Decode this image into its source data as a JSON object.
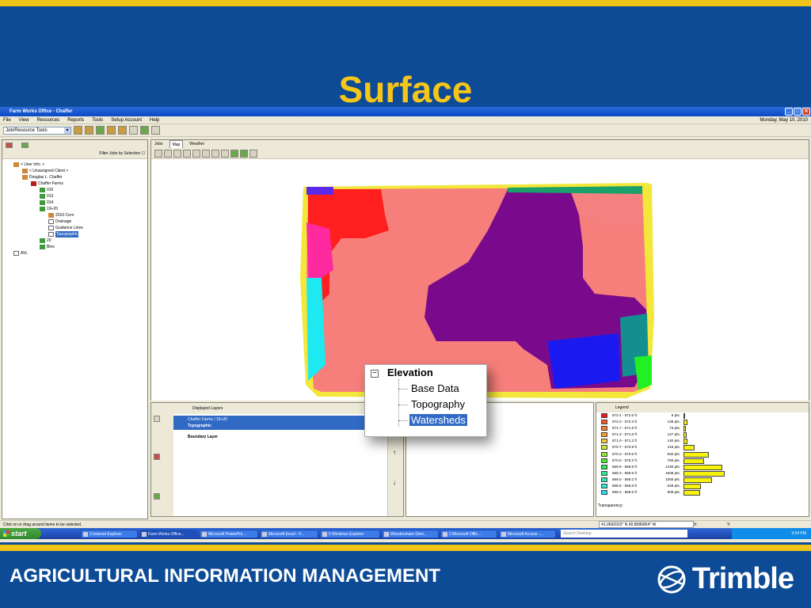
{
  "slide": {
    "title": "Surface",
    "footer": "AGRICULTURAL INFORMATION MANAGEMENT",
    "logo_text": "Trimble"
  },
  "window": {
    "title": "Farm Works Office - Chaffer"
  },
  "menu": {
    "items": [
      "File",
      "View",
      "Resources",
      "Reports",
      "Tools",
      "Setup Account",
      "Help"
    ],
    "date": "Monday, May 10, 2010"
  },
  "toolbar": {
    "selector": "Job/Resource Tools"
  },
  "left": {
    "filter_label": "Filter Jobs by Selection",
    "tree": [
      {
        "label": "< User Info. >",
        "depth": 1,
        "icon": "user"
      },
      {
        "label": "< Unassigned Client >",
        "depth": 2,
        "icon": "user"
      },
      {
        "label": "Douglas L. Chaffer",
        "depth": 2,
        "icon": "user"
      },
      {
        "label": "Chaffer Farms",
        "depth": 3,
        "icon": "farm"
      },
      {
        "label": "010",
        "depth": 4,
        "icon": "field"
      },
      {
        "label": "013",
        "depth": 4,
        "icon": "field"
      },
      {
        "label": "014",
        "depth": 4,
        "icon": "field"
      },
      {
        "label": "19+20",
        "depth": 4,
        "icon": "field"
      },
      {
        "label": "2010 Corn",
        "depth": 5,
        "icon": "user"
      },
      {
        "label": "Drainage",
        "depth": 5,
        "icon": "doc"
      },
      {
        "label": "Guidance Lines",
        "depth": 5,
        "icon": "doc"
      },
      {
        "label": "Topographic",
        "depth": 5,
        "icon": "doc",
        "selected": true
      },
      {
        "label": "20",
        "depth": 4,
        "icon": "field"
      },
      {
        "label": "Bins",
        "depth": 4,
        "icon": "field"
      },
      {
        "label": "AVL",
        "depth": 1,
        "icon": "doc"
      }
    ]
  },
  "tabs": [
    "Jobs",
    "Map",
    "Weather"
  ],
  "layers": {
    "header": "Displayed Layers",
    "selected_line1": "Chaffer Farms / 19+20",
    "selected_line2": "Topographic",
    "second": "Boundary Layer"
  },
  "legend": {
    "header": "Legend",
    "transparency": "Transparency:",
    "rows": [
      {
        "range": "572.4 - 572.6 ft",
        "count": "9 pts.",
        "color": "#e41a1a",
        "n": 9
      },
      {
        "range": "572.0 - 572.3 ft",
        "count": "139 pts.",
        "color": "#f2542a",
        "n": 139
      },
      {
        "range": "571.7 - 571.9 ft",
        "count": "73 pts.",
        "color": "#f47c2c",
        "n": 73
      },
      {
        "range": "571.3 - 571.6 ft",
        "count": "127 pts.",
        "color": "#f49c2e",
        "n": 127
      },
      {
        "range": "571.0 - 571.2 ft",
        "count": "140 pts.",
        "color": "#f4c43a",
        "n": 140
      },
      {
        "range": "570.7 - 570.9 ft",
        "count": "416 pts.",
        "color": "#c8e63a",
        "n": 416
      },
      {
        "range": "570.3 - 570.6 ft",
        "count": "932 pts.",
        "color": "#8be83a",
        "n": 932
      },
      {
        "range": "570.0 - 570.2 ft",
        "count": "760 pts.",
        "color": "#4ee83a",
        "n": 760
      },
      {
        "range": "569.6 - 569.9 ft",
        "count": "1430 pts.",
        "color": "#2ee85a",
        "n": 1430
      },
      {
        "range": "569.3 - 569.5 ft",
        "count": "1508 pts.",
        "color": "#2ee88a",
        "n": 1508
      },
      {
        "range": "569.0 - 569.2 ft",
        "count": "1055 pts.",
        "color": "#2ee8b0",
        "n": 1055
      },
      {
        "range": "568.6 - 568.8 ft",
        "count": "648 pts.",
        "color": "#2ee8d6",
        "n": 648
      },
      {
        "range": "568.2 - 568.5 ft",
        "count": "605 pts.",
        "color": "#2ed8e8",
        "n": 605
      }
    ]
  },
  "popup": {
    "title": "Elevation",
    "items": [
      "Base Data",
      "Topography",
      "Watersheds"
    ],
    "selected": "Watersheds"
  },
  "status": {
    "text": "Click on or drag around items to be selected.",
    "coord": "41.0692022° N   90.8586854° W",
    "x_label": "X:",
    "y_label": "Y:"
  },
  "taskbar": {
    "start": "start",
    "tasks": [
      "3 Internet Explorer",
      "Farm Works Office...",
      "Microsoft PowerPoi...",
      "Microsoft Excel - F...",
      "5 Windows Explorer",
      "Wondershare Dem...",
      "2 Microsoft Offic...",
      "Microsoft Access -..."
    ],
    "search_placeholder": "Search Desktop",
    "clock": "3:04 PM"
  },
  "colors": {
    "slide_bg": "#0d4b96",
    "accent": "#f5c518",
    "selection": "#316ac5"
  }
}
